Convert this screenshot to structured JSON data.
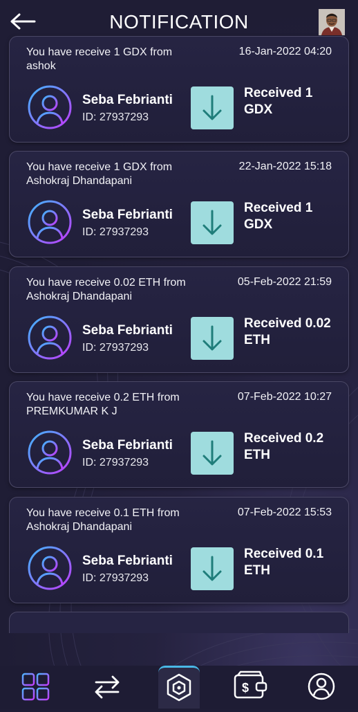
{
  "header": {
    "title": "NOTIFICATION",
    "back_icon": "arrow-left-icon",
    "profile": "user-photo"
  },
  "notifications": [
    {
      "message": "You have receive 1 GDX from ashok",
      "datetime": "16-Jan-2022 04:20",
      "sender_name": "Seba Febrianti",
      "sender_id": "ID: 27937293",
      "status": "Received 1 GDX"
    },
    {
      "message": "You have receive 1 GDX from Ashokraj Dhandapani",
      "datetime": "22-Jan-2022 15:18",
      "sender_name": "Seba Febrianti",
      "sender_id": "ID: 27937293",
      "status": "Received 1 GDX"
    },
    {
      "message": "You have receive 0.02 ETH from Ashokraj Dhandapani",
      "datetime": "05-Feb-2022 21:59",
      "sender_name": "Seba Febrianti",
      "sender_id": "ID: 27937293",
      "status": "Received 0.02 ETH"
    },
    {
      "message": "You have receive 0.2 ETH from PREMKUMAR K J",
      "datetime": "07-Feb-2022 10:27",
      "sender_name": "Seba Febrianti",
      "sender_id": "ID: 27937293",
      "status": "Received 0.2 ETH"
    },
    {
      "message": "You have receive 0.1 ETH from Ashokraj Dhandapani",
      "datetime": "07-Feb-2022 15:53",
      "sender_name": "Seba Febrianti",
      "sender_id": "ID: 27937293",
      "status": "Received 0.1 ETH"
    }
  ],
  "bottom_nav": {
    "items": [
      "dashboard-grid-icon",
      "transfer-arrows-icon",
      "hexagon-logo-icon",
      "wallet-dollar-icon",
      "profile-icon"
    ],
    "active": "hexagon-logo-icon"
  },
  "colors": {
    "background": "#221f3a",
    "card": "#262443",
    "accent_cyan": "#9fdcde",
    "avatar_gradient_start": "#3fb6ff",
    "avatar_gradient_end": "#c03cff",
    "active_tab": "#49b8e6"
  }
}
